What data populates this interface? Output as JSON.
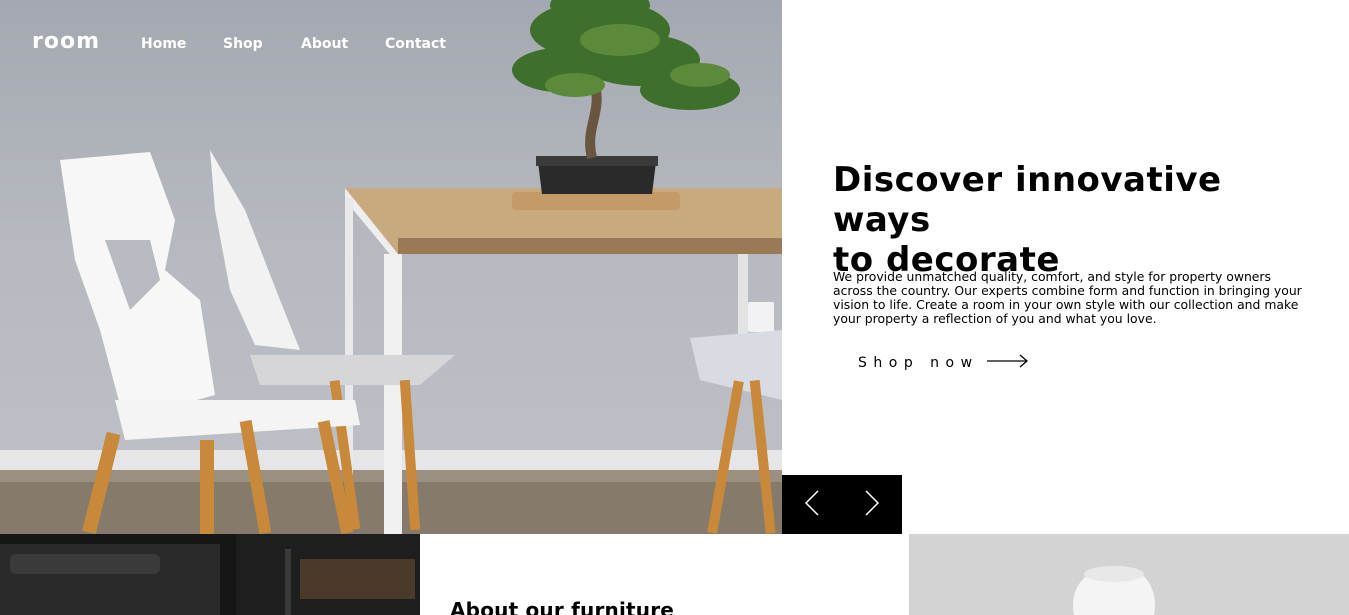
{
  "nav": {
    "logo": "room",
    "links": [
      "Home",
      "Shop",
      "About",
      "Contact"
    ]
  },
  "hero": {
    "headline_line1": "Discover innovative ways",
    "headline_line2": "to decorate",
    "description": "We provide unmatched quality, comfort, and style for property owners across the country. Our experts combine form and function in bringing your vision to life. Create a room in your own style with our collection and make your property a reflection of you and what you love.",
    "cta_label": "Shop now",
    "cta_icon": "arrow-right-icon"
  },
  "slider": {
    "prev_icon": "chevron-left-icon",
    "next_icon": "chevron-right-icon"
  },
  "about": {
    "title": "About our furniture"
  },
  "colors": {
    "text": "#000000",
    "nav_text": "#ffffff",
    "slider_bg": "#000000",
    "background": "#ffffff"
  }
}
